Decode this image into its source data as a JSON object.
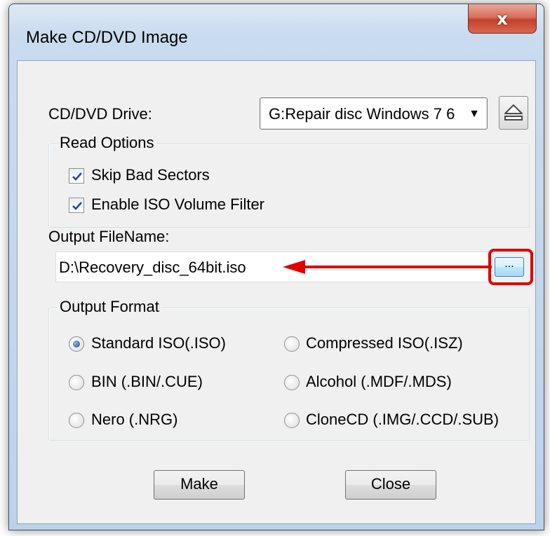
{
  "window": {
    "title": "Make CD/DVD Image",
    "close_glyph": "x"
  },
  "drive": {
    "label": "CD/DVD Drive:",
    "selected": "G:Repair disc Windows 7 6",
    "arrow": "▼",
    "eject_icon": "eject-icon"
  },
  "read_options": {
    "title": "Read Options",
    "items": [
      {
        "label": "Skip Bad Sectors",
        "checked": true
      },
      {
        "label": "Enable ISO Volume Filter",
        "checked": true
      }
    ]
  },
  "output": {
    "label": "Output FileName:",
    "value": "D:\\Recovery_disc_64bit.iso",
    "browse_label": "...",
    "annotation_color": "#e00000"
  },
  "format": {
    "title": "Output Format",
    "options": [
      {
        "label": "Standard ISO(.ISO)",
        "selected": true
      },
      {
        "label": "Compressed ISO(.ISZ)",
        "selected": false
      },
      {
        "label": "BIN (.BIN/.CUE)",
        "selected": false
      },
      {
        "label": "Alcohol (.MDF/.MDS)",
        "selected": false
      },
      {
        "label": "Nero (.NRG)",
        "selected": false
      },
      {
        "label": "CloneCD (.IMG/.CCD/.SUB)",
        "selected": false
      }
    ]
  },
  "buttons": {
    "make": "Make",
    "close": "Close"
  }
}
